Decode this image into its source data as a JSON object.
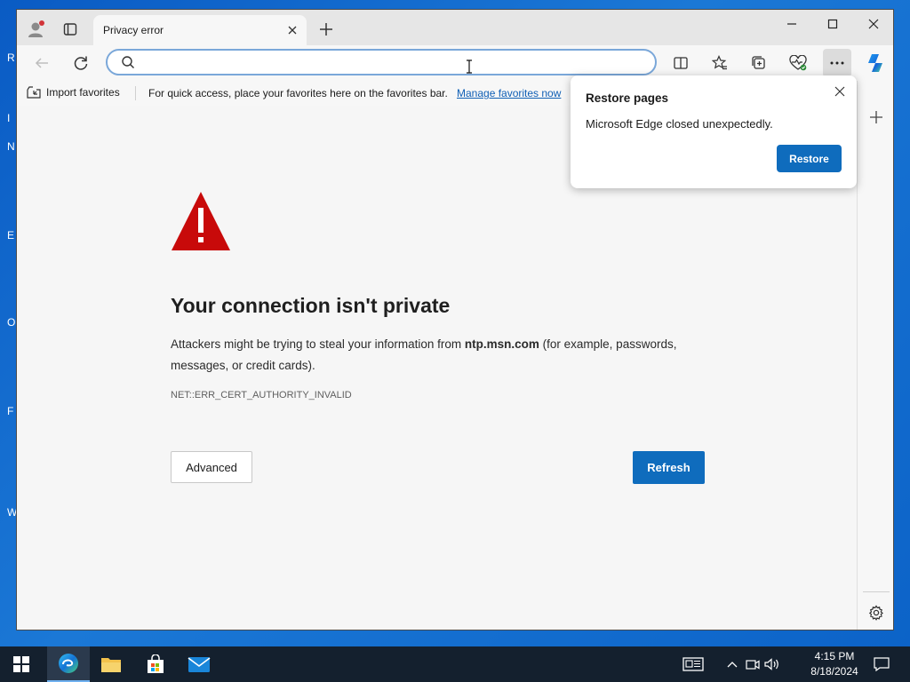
{
  "desktop": {
    "left_letters": [
      "R",
      "I",
      "N",
      "E",
      "O",
      "F",
      "W"
    ]
  },
  "tab": {
    "title": "Privacy error"
  },
  "address_bar": {
    "value": "",
    "placeholder": ""
  },
  "favorites_bar": {
    "import_label": "Import favorites",
    "hint_text": "For quick access, place your favorites here on the favorites bar.",
    "manage_link": "Manage favorites now"
  },
  "error_page": {
    "title": "Your connection isn't private",
    "desc_before": "Attackers might be trying to steal your information from ",
    "host": "ntp.msn.com",
    "desc_after": " (for example, passwords, messages, or credit cards).",
    "error_code": "NET::ERR_CERT_AUTHORITY_INVALID",
    "advanced_label": "Advanced",
    "refresh_label": "Refresh"
  },
  "restore_popup": {
    "title": "Restore pages",
    "message": "Microsoft Edge closed unexpectedly.",
    "restore_label": "Restore"
  },
  "taskbar": {
    "time": "4:15 PM",
    "date": "8/18/2024"
  },
  "colors": {
    "accent": "#0f6cbd",
    "warning": "#c80a0a",
    "taskbar": "#14202e"
  }
}
